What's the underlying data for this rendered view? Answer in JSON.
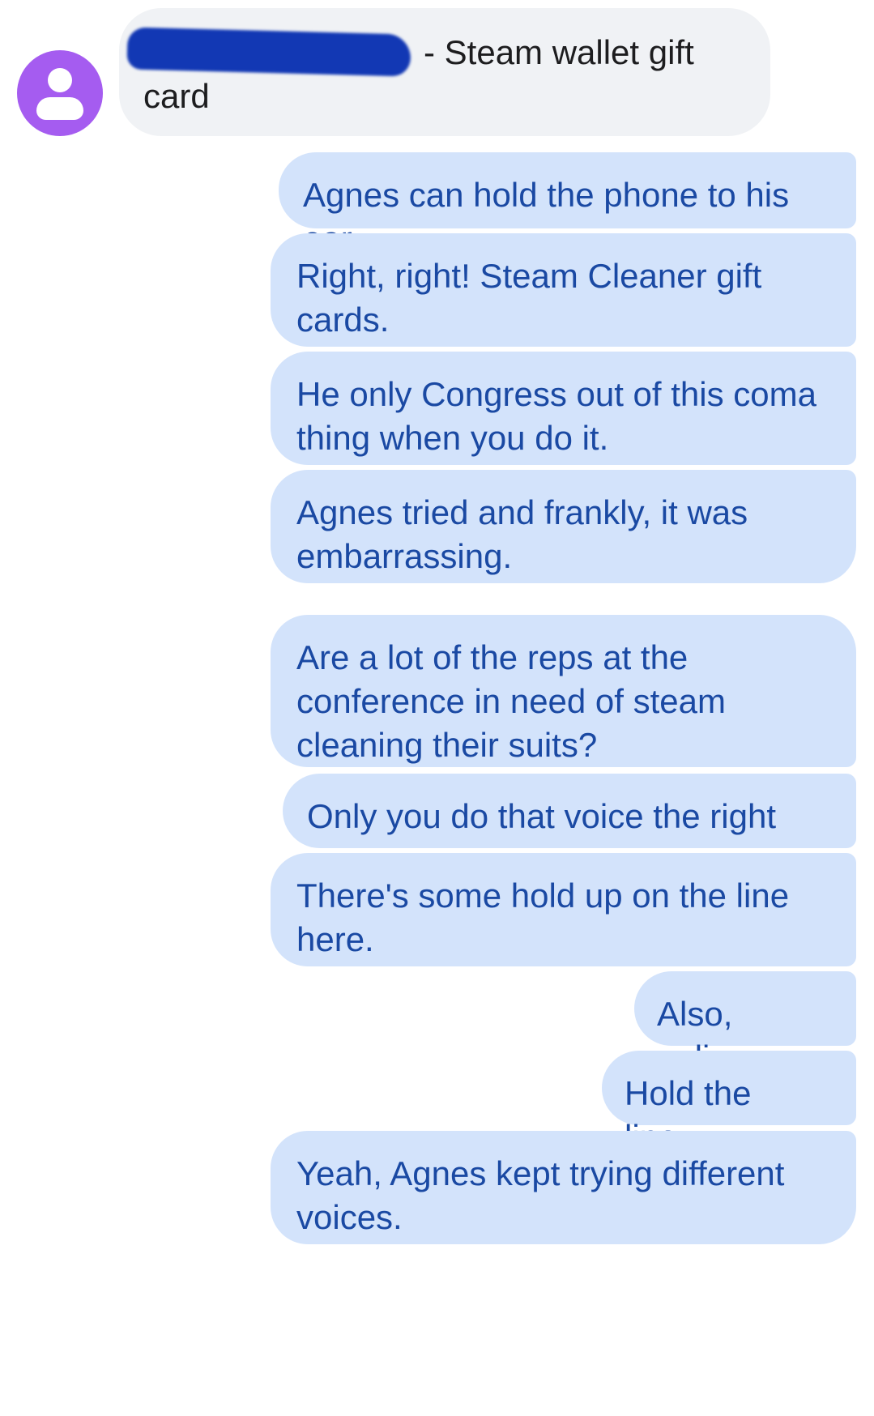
{
  "incoming_message": {
    "text_after_redaction": "- Steam wallet gift card"
  },
  "outgoing_messages": [
    {
      "text": "Agnes can hold the phone to his ear."
    },
    {
      "text": "Right, right!  Steam Cleaner gift cards."
    },
    {
      "text": "He only Congress out of this coma thing when you do it."
    },
    {
      "text": "Agnes tried and frankly, it was embarrassing."
    },
    {
      "text": "Are a lot of the reps at the conference in need of steam cleaning their suits?"
    },
    {
      "text": "Only you do that voice the right way."
    },
    {
      "text": "There's some hold up on the line here."
    },
    {
      "text": "Also, online."
    },
    {
      "text": "Hold the line..."
    },
    {
      "text": "Yeah, Agnes kept trying different voices."
    }
  ],
  "colors": {
    "incoming_bubble": "#f0f2f5",
    "outgoing_bubble": "#d3e3fb",
    "outgoing_text": "#1a49a3",
    "incoming_text": "#1d1d1f",
    "avatar": "#a55cf0",
    "redaction": "#1238b4"
  },
  "icons": {
    "avatar": "person-icon"
  }
}
